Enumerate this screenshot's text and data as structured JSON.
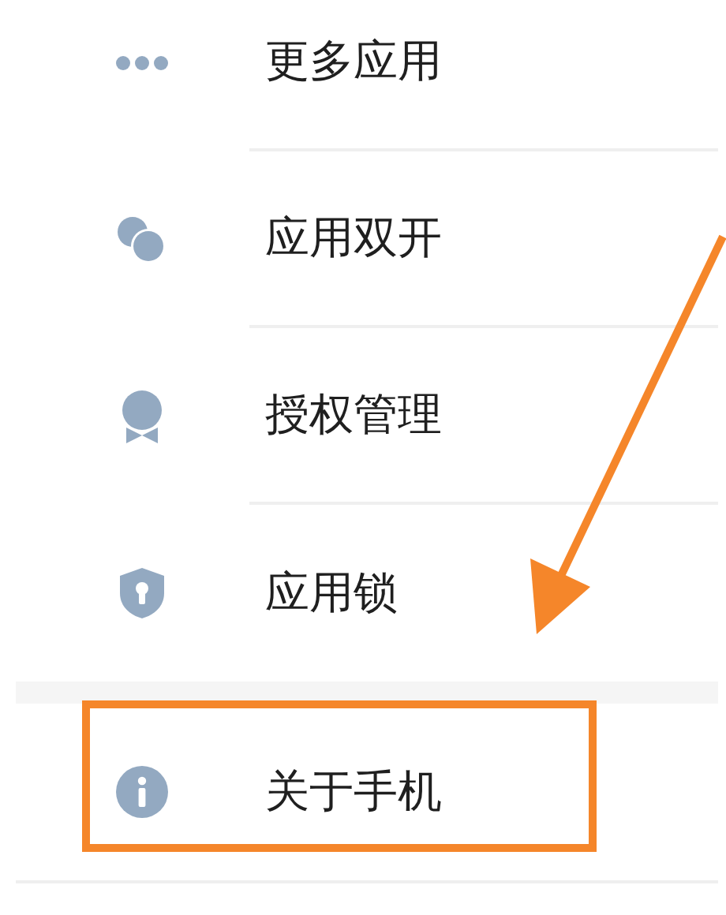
{
  "menu": [
    {
      "label": "更多应用",
      "kind": "more",
      "highlighted": false
    },
    {
      "label": "应用双开",
      "kind": "dual",
      "highlighted": false
    },
    {
      "label": "授权管理",
      "kind": "medal",
      "highlighted": false
    },
    {
      "label": "应用锁",
      "kind": "lock",
      "highlighted": false
    }
  ],
  "about": [
    {
      "label": "关于手机",
      "kind": "info",
      "highlighted": true
    }
  ]
}
